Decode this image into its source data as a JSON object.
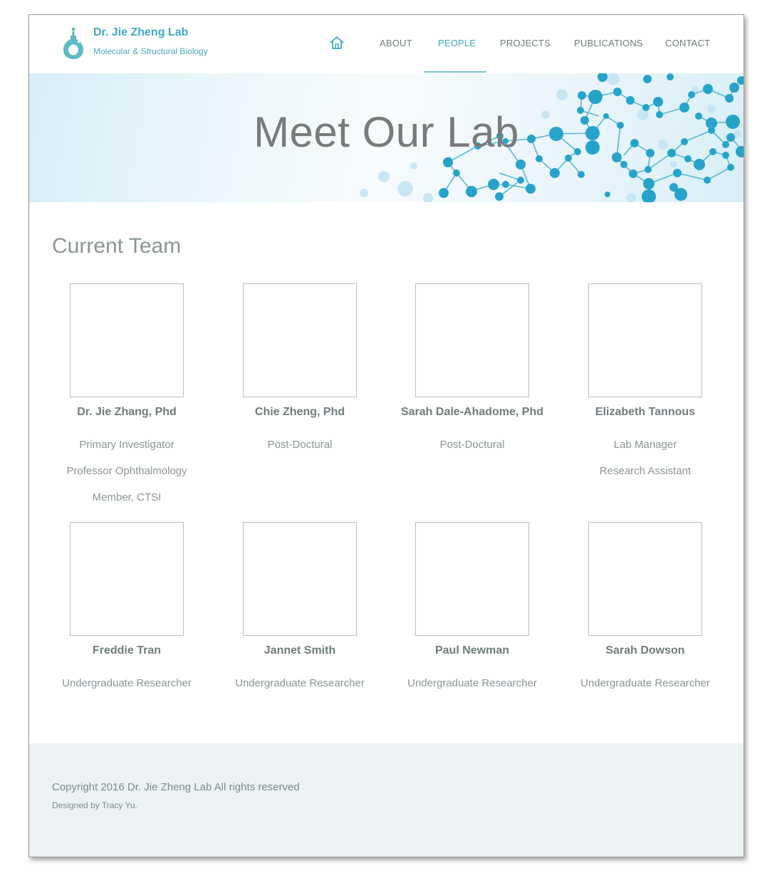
{
  "header": {
    "brand_name": "Dr. Jie Zheng Lab",
    "brand_subtitle": "Molecular & Structural Biology",
    "logo_icon": "flask-icon",
    "home_icon": "home-icon",
    "nav": [
      {
        "label": "ABOUT",
        "active": false
      },
      {
        "label": "PEOPLE",
        "active": true
      },
      {
        "label": "PROJECTS",
        "active": false
      },
      {
        "label": "PUBLICATIONS",
        "active": false
      },
      {
        "label": "CONTACT",
        "active": false
      }
    ]
  },
  "hero": {
    "title": "Meet Our Lab"
  },
  "team": {
    "title": "Current Team",
    "members": [
      {
        "name": "Dr. Jie Zhang, Phd",
        "roles": [
          "Primary Investigator",
          "Professor Ophthalmology",
          "Member, CTSI"
        ]
      },
      {
        "name": "Chie Zheng, Phd",
        "roles": [
          "Post-Doctural"
        ]
      },
      {
        "name": "Sarah Dale-Ahadome, Phd",
        "roles": [
          "Post-Doctural"
        ]
      },
      {
        "name": "Elizabeth Tannous",
        "roles": [
          "Lab Manager",
          "Research Assistant"
        ]
      },
      {
        "name": "Freddie Tran",
        "roles": [
          "Undergraduate Researcher"
        ]
      },
      {
        "name": "Jannet Smith",
        "roles": [
          "Undergraduate Researcher"
        ]
      },
      {
        "name": "Paul Newman",
        "roles": [
          "Undergraduate Researcher"
        ]
      },
      {
        "name": "Sarah Dowson",
        "roles": [
          "Undergraduate Researcher"
        ]
      }
    ]
  },
  "footer": {
    "copyright": "Copyright 2016 Dr. Jie Zheng Lab All rights reserved",
    "designer": "Designed by Tracy Yu."
  },
  "colors": {
    "accent": "#3fa7c5",
    "molecule": "#2aa4c9",
    "footer_bg": "#ecf2f4",
    "text_muted": "#8a9499"
  }
}
